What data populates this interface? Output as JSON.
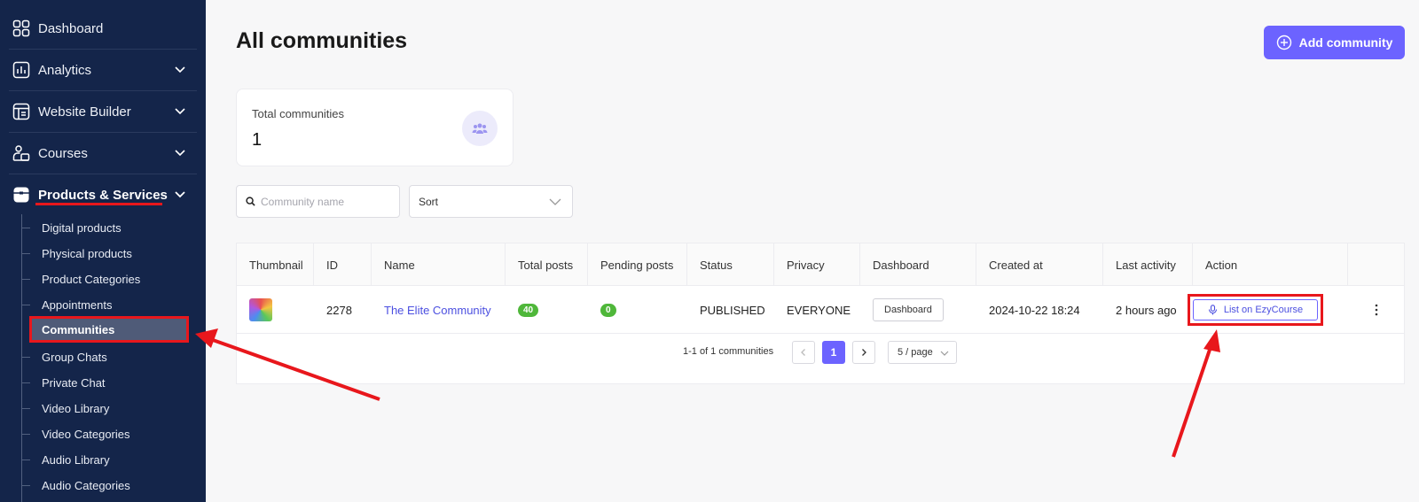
{
  "sidebar": {
    "items": [
      {
        "label": "Dashboard",
        "icon": "grid-icon"
      },
      {
        "label": "Analytics",
        "icon": "chart-icon"
      },
      {
        "label": "Website Builder",
        "icon": "layout-icon"
      },
      {
        "label": "Courses",
        "icon": "courses-icon"
      },
      {
        "label": "Products & Services",
        "icon": "box-icon"
      }
    ],
    "sub_items": [
      "Digital products",
      "Physical products",
      "Product Categories",
      "Appointments",
      "Communities",
      "Group Chats",
      "Private Chat",
      "Video Library",
      "Video Categories",
      "Audio Library",
      "Audio Categories"
    ]
  },
  "header": {
    "title": "All communities",
    "add_button": "Add community"
  },
  "stats": {
    "label": "Total communities",
    "value": "1"
  },
  "filters": {
    "search_placeholder": "Community name",
    "sort_label": "Sort"
  },
  "table": {
    "columns": [
      "Thumbnail",
      "ID",
      "Name",
      "Total posts",
      "Pending posts",
      "Status",
      "Privacy",
      "Dashboard",
      "Created at",
      "Last activity",
      "Action"
    ],
    "row": {
      "id": "2278",
      "name": "The Elite Community",
      "total_posts": "40",
      "pending_posts": "0",
      "status": "PUBLISHED",
      "privacy": "EVERYONE",
      "dashboard_button": "Dashboard",
      "created_at": "2024-10-22 18:24",
      "last_activity": "2 hours ago",
      "action_button": "List on EzyCourse"
    }
  },
  "pagination": {
    "summary": "1-1 of 1 communities",
    "current_page": "1",
    "page_size": "5 / page"
  },
  "colors": {
    "sidebar_bg": "#14254a",
    "accent": "#6c63ff",
    "highlight_red": "#e8171c",
    "badge_green": "#4fb73a"
  }
}
